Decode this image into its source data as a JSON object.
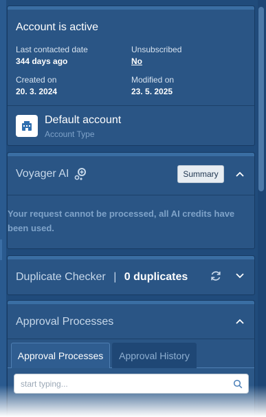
{
  "account": {
    "status_title": "Account is active",
    "last_contacted_label": "Last contacted date",
    "last_contacted_value": "344 days ago",
    "unsubscribed_label": "Unsubscribed",
    "unsubscribed_value": "No",
    "created_label": "Created on",
    "created_value": "20. 3. 2024",
    "modified_label": "Modified on",
    "modified_value": "23. 5. 2025",
    "type_title": "Default account",
    "type_subtitle": "Account Type",
    "type_icon": "building-icon"
  },
  "voyager": {
    "title": "Voyager AI",
    "icon": "ai-sparkle-icon",
    "summary_label": "Summary",
    "message": "Your request cannot be processed, all AI credits have been used."
  },
  "duplicate": {
    "title": "Duplicate Checker",
    "separator": "|",
    "count_text": "0 duplicates"
  },
  "approval": {
    "title": "Approval Processes",
    "tabs": [
      {
        "label": "Approval Processes",
        "active": true
      },
      {
        "label": "Approval History",
        "active": false
      }
    ],
    "search_placeholder": "start typing..."
  },
  "colors": {
    "background": "#204b7b",
    "card": "#2a5585",
    "accent_muted": "#7fa3c9"
  }
}
